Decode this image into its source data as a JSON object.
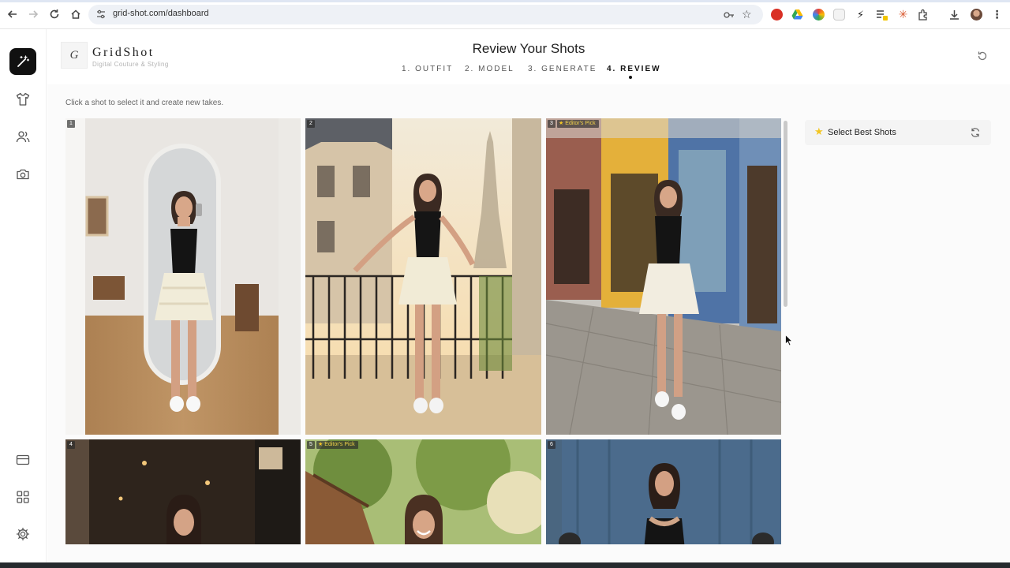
{
  "browser": {
    "url": "grid-shot.com/dashboard"
  },
  "brand": {
    "logo_letter": "G",
    "name": "GridShot",
    "tagline": "Digital Couture & Styling"
  },
  "header": {
    "title": "Review Your Shots",
    "steps": [
      {
        "label": "1. OUTFIT",
        "active": false
      },
      {
        "label": "2. MODEL",
        "active": false
      },
      {
        "label": "3. GENERATE",
        "active": false
      },
      {
        "label": "4. REVIEW",
        "active": true
      }
    ]
  },
  "main": {
    "hint": "Click a shot to select it and create new takes.",
    "shots": [
      {
        "number": "1",
        "badge": ""
      },
      {
        "number": "2",
        "badge": ""
      },
      {
        "number": "3",
        "badge": "Editor's Pick"
      },
      {
        "number": "4",
        "badge": ""
      },
      {
        "number": "5",
        "badge": "Editor's Pick"
      },
      {
        "number": "6",
        "badge": ""
      }
    ]
  },
  "panel": {
    "select_best_label": "Select Best Shots"
  },
  "colors": {
    "accent": "#111111",
    "star": "#f3c623",
    "background": "#fbfbfb"
  },
  "icons": {
    "rail": [
      "magic-wand-icon",
      "shirt-icon",
      "users-icon",
      "camera-icon",
      "credit-card-icon",
      "grid-icon",
      "settings-icon"
    ]
  }
}
